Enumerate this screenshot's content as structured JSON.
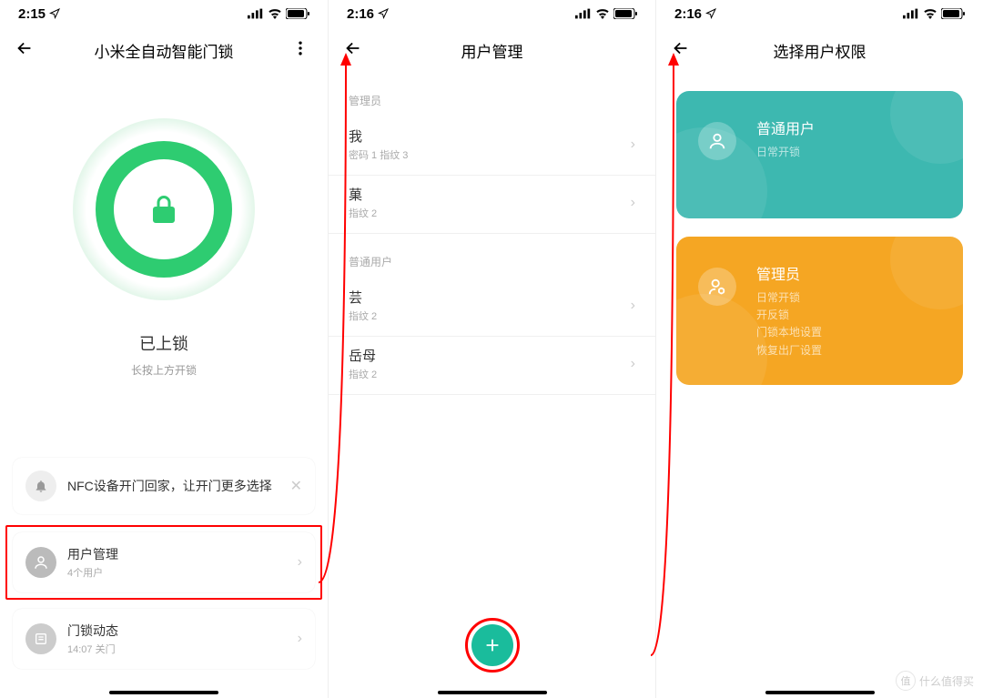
{
  "statusbar": {
    "time1": "2:15",
    "time2": "2:16",
    "time3": "2:16"
  },
  "s1": {
    "title": "小米全自动智能门锁",
    "lockStatus": "已上锁",
    "lockHint": "长按上方开锁",
    "nfcCard": {
      "text": "NFC设备开门回家，让开门更多选择"
    },
    "userMgmt": {
      "title": "用户管理",
      "sub": "4个用户"
    },
    "lockLog": {
      "title": "门锁动态",
      "sub": "14:07 关门"
    }
  },
  "s2": {
    "title": "用户管理",
    "adminLabel": "管理员",
    "normalLabel": "普通用户",
    "admins": [
      {
        "name": "我",
        "detail": "密码 1  指纹 3"
      },
      {
        "name": "菓",
        "detail": "指纹 2"
      }
    ],
    "users": [
      {
        "name": "芸",
        "detail": "指纹 2"
      },
      {
        "name": "岳母",
        "detail": "指纹 2"
      }
    ]
  },
  "s3": {
    "title": "选择用户权限",
    "normal": {
      "title": "普通用户",
      "lines": [
        "日常开锁"
      ]
    },
    "admin": {
      "title": "管理员",
      "lines": [
        "日常开锁",
        "开反锁",
        "门锁本地设置",
        "恢复出厂设置"
      ]
    }
  },
  "watermark": "什么值得买"
}
